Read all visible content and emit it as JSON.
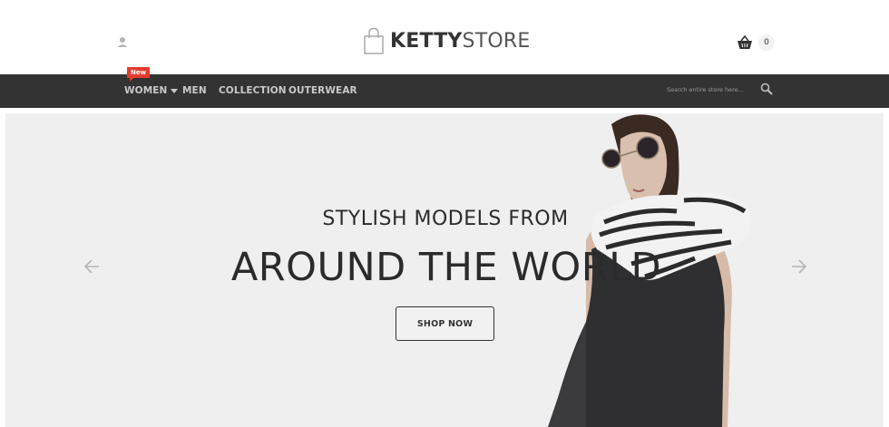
{
  "header": {
    "logo_bold": "KETTY",
    "logo_light": "STORE",
    "user_icon": "user-icon",
    "cart_icon": "basket-icon",
    "cart_count": "0"
  },
  "nav": {
    "badge": "New",
    "items": [
      {
        "label": "WOMEN",
        "has_dropdown": true
      },
      {
        "label": "MEN"
      },
      {
        "label": "COLLECTION"
      },
      {
        "label": "OUTERWEAR"
      }
    ],
    "search_placeholder": "Search entire store here...",
    "search_icon": "search-icon"
  },
  "hero": {
    "subheading": "STYLISH MODELS FROM",
    "heading": "AROUND THE WORLD",
    "button": "SHOP NOW",
    "prev_icon": "arrow-left-icon",
    "next_icon": "arrow-right-icon"
  },
  "colors": {
    "navbar_bg": "#333333",
    "badge_red": "#e53a2f",
    "hero_bg": "#efefef"
  }
}
